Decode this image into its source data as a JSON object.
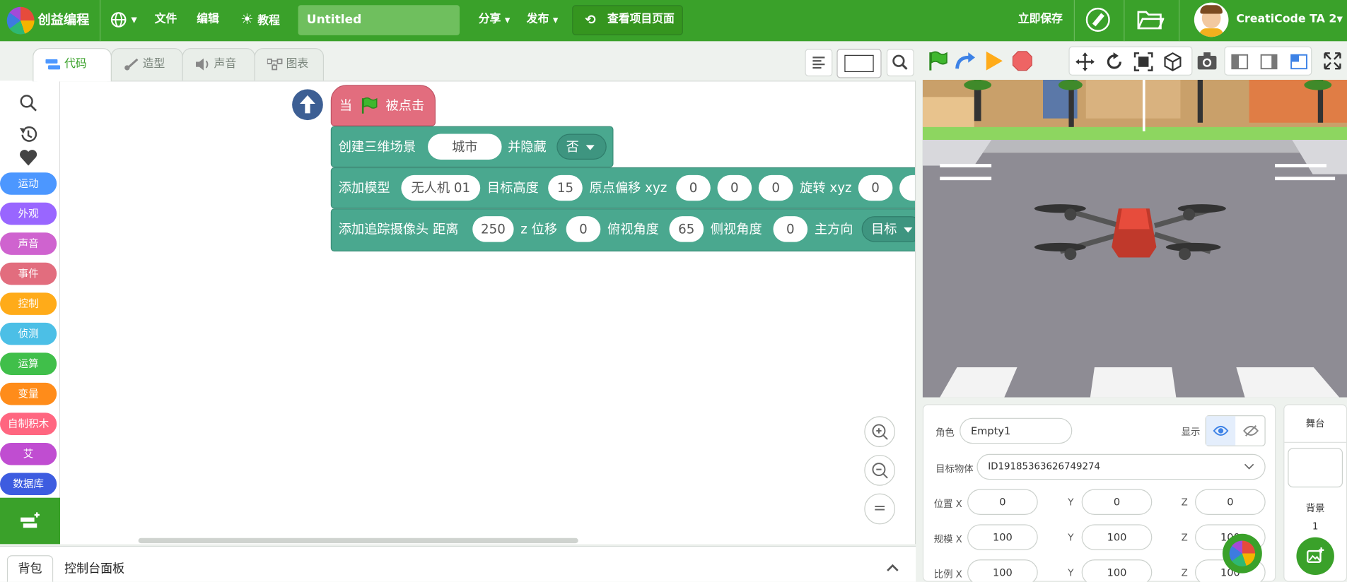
{
  "app": {
    "name": "创益编程"
  },
  "menu": {
    "file": "文件",
    "edit": "编辑",
    "tutorial": "教程",
    "share": "分享",
    "publish": "发布",
    "view_project": "查看项目页面",
    "save_now": "立即保存"
  },
  "project": {
    "title": "Untitled"
  },
  "user": {
    "name": "CreatiCode TA 2"
  },
  "tabs": [
    {
      "label": "代码"
    },
    {
      "label": "造型"
    },
    {
      "label": "声音"
    },
    {
      "label": "图表"
    }
  ],
  "categories": [
    {
      "label": "运动",
      "color": "#4c97ff"
    },
    {
      "label": "外观",
      "color": "#9966ff"
    },
    {
      "label": "声音",
      "color": "#cf63cf"
    },
    {
      "label": "事件",
      "color": "#e26d7e"
    },
    {
      "label": "控制",
      "color": "#ffab19"
    },
    {
      "label": "侦测",
      "color": "#4cbfe6"
    },
    {
      "label": "运算",
      "color": "#40bf4a"
    },
    {
      "label": "变量",
      "color": "#ff8c1a"
    },
    {
      "label": "自制积木",
      "color": "#ff6680"
    },
    {
      "label": "艾",
      "color": "#c04dd1"
    },
    {
      "label": "数据库",
      "color": "#3d5ce0"
    }
  ],
  "blocks": {
    "hat": {
      "when": "当",
      "clicked": "被点击",
      "color": "#e26d7e"
    },
    "scene": {
      "label": "创建三维场景",
      "value": "城市",
      "hide_label": "并隐藏",
      "hide_value": "否"
    },
    "model": {
      "label": "添加模型",
      "name": "无人机 01",
      "height_label": "目标高度",
      "height": "15",
      "offset_label": "原点偏移 xyz",
      "ox": "0",
      "oy": "0",
      "oz": "0",
      "rot_label": "旋转 xyz",
      "rx": "0"
    },
    "camera": {
      "label": "添加追踪摄像头 距离",
      "distance": "250",
      "z_label": "z 位移",
      "z": "0",
      "pitch_label": "俯视角度",
      "pitch": "65",
      "side_label": "侧视角度",
      "side": "0",
      "heading_label": "主方向",
      "heading": "目标"
    }
  },
  "bottom": {
    "backpack": "背包",
    "console": "控制台面板"
  },
  "sprite": {
    "role_label": "角色",
    "role_value": "Empty1",
    "show_label": "显示",
    "target_label": "目标物体",
    "target_value": "ID19185363626749274",
    "pos_label": "位置 X",
    "pos_x": "0",
    "pos_y": "0",
    "pos_z": "0",
    "scale_label": "规模 X",
    "scale_x": "100",
    "scale_y": "100",
    "scale_z": "100",
    "ratio_label": "比例 X",
    "ratio_x": "100",
    "ratio_y": "100",
    "ratio_z": "100",
    "y": "Y",
    "z": "Z"
  },
  "stage_panel": {
    "title": "舞台",
    "backdrop_label": "背景",
    "backdrop_count": "1"
  },
  "colors": {
    "brand": "#3aa12a",
    "motion_block": "#4aa88f",
    "event_block": "#e26d7e"
  }
}
